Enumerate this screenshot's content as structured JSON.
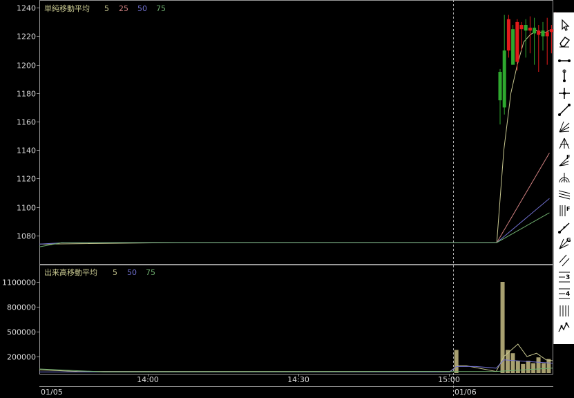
{
  "price_panel": {
    "legend_title": "単純移動平均",
    "legend_periods": [
      {
        "label": "5",
        "color": "#c8c890"
      },
      {
        "label": "25",
        "color": "#d08080"
      },
      {
        "label": "50",
        "color": "#7070d0"
      },
      {
        "label": "75",
        "color": "#70b070"
      }
    ]
  },
  "volume_panel": {
    "legend_title": "出来高移動平均",
    "legend_periods": [
      {
        "label": "5",
        "color": "#c8c890"
      },
      {
        "label": "50",
        "color": "#7070d0"
      },
      {
        "label": "75",
        "color": "#70b070"
      }
    ]
  },
  "x_axis": {
    "time_labels": [
      "14:00",
      "14:30",
      "15:00"
    ],
    "date_labels": [
      "01/05",
      "01/06"
    ]
  },
  "toolbar": {
    "tools": [
      "cursor",
      "eraser",
      "horizontal-line",
      "vertical-line",
      "cross-line",
      "trend-line",
      "fan-lines",
      "pitchfork",
      "fibonacci-fan",
      "fibonacci-arcs",
      "regression-channel",
      "fibonacci-time-zones",
      "gann-line",
      "gann-fan",
      "parallel-lines",
      "three-division-lines",
      "four-division-lines",
      "cycle-lines",
      "wave-tool"
    ]
  },
  "chart_data": [
    {
      "type": "candlestick",
      "ylim": [
        1060,
        1245
      ],
      "yticks": [
        1080,
        1100,
        1120,
        1140,
        1160,
        1180,
        1200,
        1220,
        1240
      ],
      "candles": [
        {
          "o": 1195,
          "h": 1197,
          "l": 1158,
          "c": 1175
        },
        {
          "o": 1210,
          "h": 1235,
          "l": 1165,
          "c": 1170
        },
        {
          "o": 1210,
          "h": 1235,
          "l": 1205,
          "c": 1232
        },
        {
          "o": 1225,
          "h": 1228,
          "l": 1200,
          "c": 1200
        },
        {
          "o": 1202,
          "h": 1232,
          "l": 1196,
          "c": 1230
        },
        {
          "o": 1225,
          "h": 1230,
          "l": 1210,
          "c": 1228
        },
        {
          "o": 1228,
          "h": 1232,
          "l": 1205,
          "c": 1224
        },
        {
          "o": 1224,
          "h": 1234,
          "l": 1208,
          "c": 1226
        },
        {
          "o": 1226,
          "h": 1233,
          "l": 1200,
          "c": 1222
        },
        {
          "o": 1221,
          "h": 1228,
          "l": 1195,
          "c": 1224
        },
        {
          "o": 1224,
          "h": 1230,
          "l": 1210,
          "c": 1220
        },
        {
          "o": 1220,
          "h": 1233,
          "l": 1200,
          "c": 1223
        },
        {
          "o": 1223,
          "h": 1228,
          "l": 1208,
          "c": 1225
        },
        {
          "o": 1225,
          "h": 1237,
          "l": 1210,
          "c": 1228
        }
      ],
      "series": [
        {
          "period": "5",
          "color": "#c8c890",
          "points": [
            [
              0,
              1074
            ],
            [
              12,
              1074
            ],
            [
              220,
              1075
            ],
            [
              410,
              1075
            ],
            [
              610,
              1075
            ],
            [
              655,
              1075
            ],
            [
              713,
              1075
            ],
            [
              724,
              1140
            ],
            [
              735,
              1180
            ],
            [
              745,
              1200
            ],
            [
              755,
              1216
            ],
            [
              765,
              1221
            ],
            [
              775,
              1224
            ],
            [
              785,
              1222
            ],
            [
              795,
              1224
            ]
          ]
        },
        {
          "period": "25",
          "color": "#d08080",
          "points": [
            [
              713,
              1075
            ],
            [
              795,
              1138
            ]
          ]
        },
        {
          "period": "50",
          "color": "#7070d0",
          "points": [
            [
              0,
              1074
            ],
            [
              40,
              1075
            ],
            [
              713,
              1075
            ],
            [
              795,
              1106
            ]
          ]
        },
        {
          "period": "75",
          "color": "#70b070",
          "points": [
            [
              0,
              1072
            ],
            [
              35,
              1075
            ],
            [
              713,
              1075
            ],
            [
              795,
              1096
            ]
          ]
        }
      ]
    },
    {
      "type": "bar",
      "ylim": [
        0,
        1300000
      ],
      "yticks": [
        200000,
        500000,
        800000,
        1100000
      ],
      "bars": [
        {
          "slot": 650,
          "value": 280000
        },
        {
          "slot": 722,
          "value": 1100000
        },
        {
          "slot": 730,
          "value": 280000
        },
        {
          "slot": 738,
          "value": 240000
        },
        {
          "slot": 746,
          "value": 150000
        },
        {
          "slot": 754,
          "value": 110000
        },
        {
          "slot": 762,
          "value": 150000
        },
        {
          "slot": 770,
          "value": 120000
        },
        {
          "slot": 778,
          "value": 190000
        },
        {
          "slot": 786,
          "value": 120000
        },
        {
          "slot": 794,
          "value": 170000
        }
      ],
      "series": [
        {
          "period": "5",
          "color": "#c8c890",
          "points": [
            [
              0,
              40000
            ],
            [
              60,
              20000
            ],
            [
              640,
              20000
            ],
            [
              652,
              90000
            ],
            [
              665,
              90000
            ],
            [
              712,
              20000
            ],
            [
              724,
              200000
            ],
            [
              746,
              350000
            ],
            [
              760,
              200000
            ],
            [
              775,
              240000
            ],
            [
              790,
              160000
            ],
            [
              800,
              150000
            ]
          ]
        },
        {
          "period": "50",
          "color": "#7070d0",
          "points": [
            [
              0,
              15000
            ],
            [
              640,
              15000
            ],
            [
              650,
              80000
            ],
            [
              680,
              80000
            ],
            [
              712,
              60000
            ],
            [
              724,
              160000
            ],
            [
              800,
              120000
            ]
          ]
        },
        {
          "period": "75",
          "color": "#70b070",
          "points": [
            [
              0,
              50000
            ],
            [
              100,
              15000
            ],
            [
              712,
              20000
            ],
            [
              800,
              60000
            ]
          ]
        }
      ]
    }
  ]
}
